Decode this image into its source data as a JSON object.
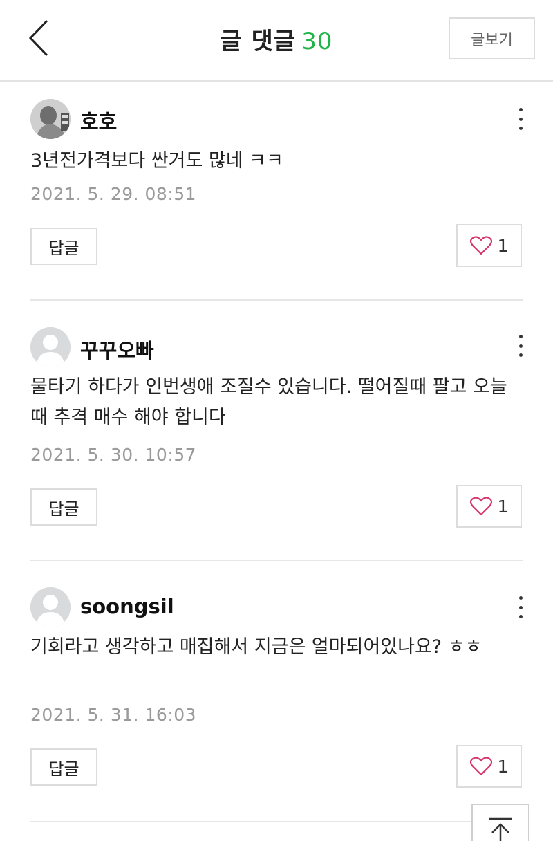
{
  "header": {
    "title": "글 댓글",
    "comment_count": "30",
    "view_post_label": "글보기"
  },
  "comments": [
    {
      "author": "호호",
      "body": "3년전가격보다 싼거도 많네 ㅋㅋ",
      "date": "2021. 5. 29. 08:51",
      "reply_label": "답글",
      "likes": "1"
    },
    {
      "author": "꾸꾸오빠",
      "body": "물타기 하다가 인번생애 조질수 있습니다. 떨어질때 팔고 오늘때 추격 매수 해야 합니다",
      "date": "2021. 5. 30. 10:57",
      "reply_label": "답글",
      "likes": "1"
    },
    {
      "author": "soongsil",
      "body": "기회라고 생각하고 매집해서 지금은 얼마되어있나요? ㅎㅎ",
      "date": "2021. 5. 31. 16:03",
      "reply_label": "답글",
      "likes": "1"
    }
  ],
  "colors": {
    "accent_green": "#1fb34a",
    "heart_pink": "#d6336c",
    "date_gray": "#9a9a9a",
    "border_gray": "#dcdcdc"
  },
  "icons": [
    "back-chevron-icon",
    "more-vertical-icon",
    "heart-icon",
    "arrow-up-icon"
  ]
}
